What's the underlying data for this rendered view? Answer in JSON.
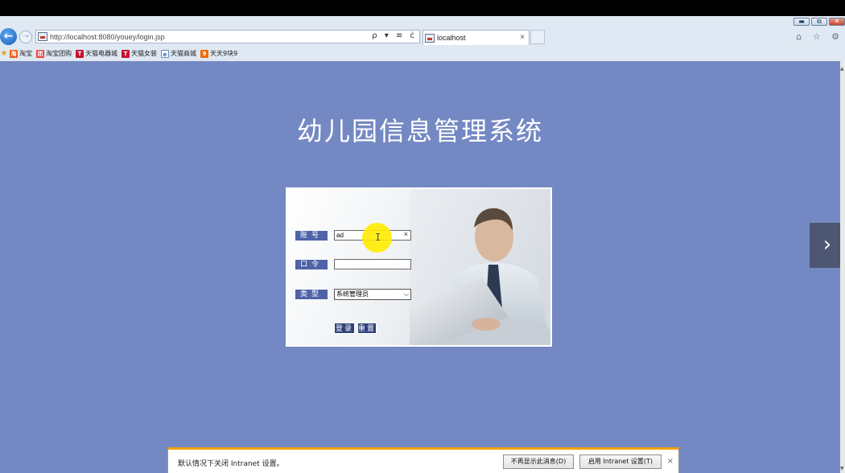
{
  "browser": {
    "url": "http://localhost:8080/youey/login.jsp",
    "tab_title": "localhost",
    "tab_close": "×",
    "back_glyph": "←",
    "forward_glyph": "→",
    "addr_tools": "ρ ▾ ≡ ċ",
    "right_icons": "⌂ ☆ ⚙",
    "window_buttons": [
      "▬",
      "⧉",
      "✕"
    ]
  },
  "favorites": [
    {
      "icon": "tao",
      "glyph": "淘",
      "label": "淘宝"
    },
    {
      "icon": "tuan",
      "glyph": "团",
      "label": "淘宝团购"
    },
    {
      "icon": "tmall",
      "glyph": "T",
      "label": "天猫电器城"
    },
    {
      "icon": "tmall",
      "glyph": "T",
      "label": "天猫女装"
    },
    {
      "icon": "ie",
      "glyph": "e",
      "label": "天猫商城"
    },
    {
      "icon": "tt",
      "glyph": "9",
      "label": "天天9块9"
    }
  ],
  "page": {
    "title": "幼儿园信息管理系统",
    "next_glyph": "›"
  },
  "login": {
    "account_label": "账号",
    "account_value": "ad",
    "account_clear": "×",
    "password_label": "口令",
    "password_value": "",
    "type_label": "类型",
    "type_selected": "系统管理员",
    "type_arrow": "⌵",
    "login_button": "登录",
    "reset_button": "重置"
  },
  "cursor": {
    "glyph": "I"
  },
  "notification": {
    "message": "默认情况下关闭 Intranet 设置。",
    "dont_show_button": "不再显示此消息(D)",
    "enable_button": "启用 Intranet 设置(T)",
    "close": "×"
  },
  "colors": {
    "page_bg": "#7489c3",
    "label_bg": "#4f63a8",
    "button_bg": "#2d3e7a",
    "notify_accent": "#f0a30a"
  }
}
